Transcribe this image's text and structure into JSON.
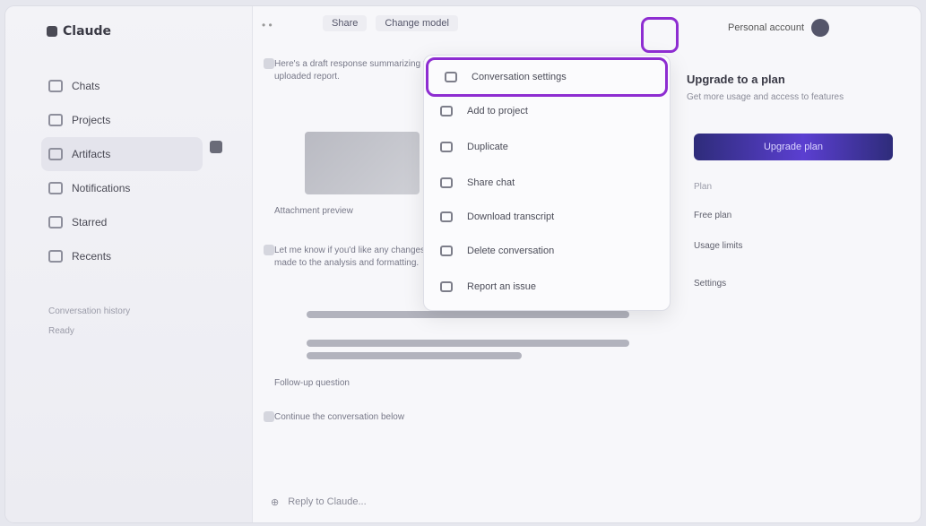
{
  "sidebar": {
    "brand": "Claude",
    "nav": [
      {
        "label": "Chats"
      },
      {
        "label": "Projects"
      },
      {
        "label": "Artifacts"
      },
      {
        "label": "Notifications"
      },
      {
        "label": "Starred"
      },
      {
        "label": "Recents"
      }
    ],
    "footer_title": "Conversation history",
    "footer_sub": "Ready"
  },
  "main": {
    "tabs": [
      "Share",
      "Change model"
    ],
    "input_placeholder": "Reply to Claude...",
    "messages": [
      "Here's a draft response summarizing the uploaded report.",
      "Attachment preview",
      "Let me know if you'd like any changes made to the analysis and formatting.",
      "Follow-up question",
      "Continue the conversation below"
    ]
  },
  "menu": {
    "items": [
      {
        "label": "Conversation settings",
        "icon": "gear-icon"
      },
      {
        "label": "Add to project",
        "icon": "folder-icon"
      },
      {
        "label": "Duplicate",
        "icon": "copy-icon"
      },
      {
        "label": "Share chat",
        "icon": "share-icon"
      },
      {
        "label": "Download transcript",
        "icon": "download-icon"
      },
      {
        "label": "Delete conversation",
        "icon": "trash-icon"
      },
      {
        "label": "Report an issue",
        "icon": "flag-icon"
      }
    ]
  },
  "right_panel": {
    "account_label": "Personal account",
    "card_title": "Upgrade to a plan",
    "card_sub": "Get more usage and access to features",
    "cta_label": "Upgrade plan",
    "info_label": "Plan",
    "info_rows": [
      "Free plan",
      "Usage limits",
      "Settings"
    ]
  },
  "colors": {
    "accent": "#8e2dd1",
    "cta_start": "#2e2c7a",
    "cta_mid": "#5b3fd1"
  }
}
